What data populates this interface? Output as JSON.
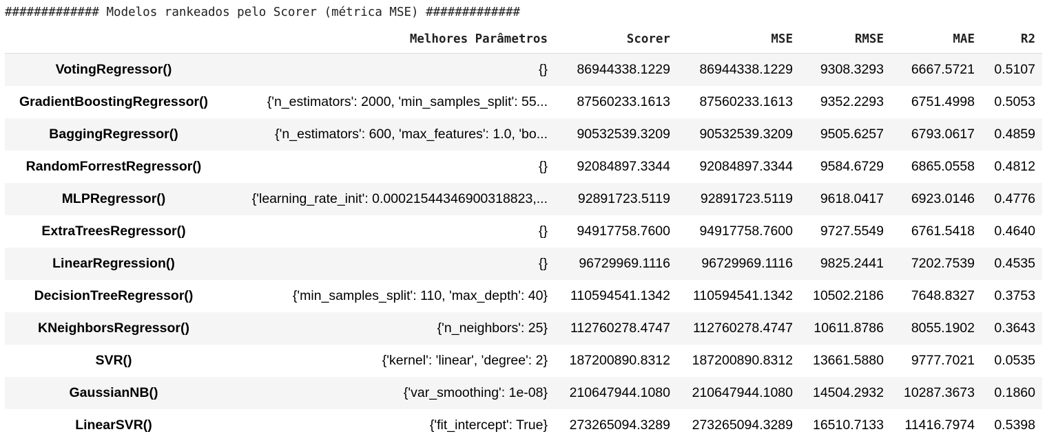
{
  "title": "############# Modelos rankeados pelo Scorer (métrica MSE) #############",
  "table": {
    "columns": [
      "",
      "Melhores Parâmetros",
      "Scorer",
      "MSE",
      "RMSE",
      "MAE",
      "R2"
    ],
    "rows": [
      {
        "model": "VotingRegressor()",
        "params": "{}",
        "scorer": "86944338.1229",
        "mse": "86944338.1229",
        "rmse": "9308.3293",
        "mae": "6667.5721",
        "r2": "0.5107"
      },
      {
        "model": "GradientBoostingRegressor()",
        "params": "{'n_estimators': 2000, 'min_samples_split': 55...",
        "scorer": "87560233.1613",
        "mse": "87560233.1613",
        "rmse": "9352.2293",
        "mae": "6751.4998",
        "r2": "0.5053"
      },
      {
        "model": "BaggingRegressor()",
        "params": "{'n_estimators': 600, 'max_features': 1.0, 'bo...",
        "scorer": "90532539.3209",
        "mse": "90532539.3209",
        "rmse": "9505.6257",
        "mae": "6793.0617",
        "r2": "0.4859"
      },
      {
        "model": "RandomForrestRegressor()",
        "params": "{}",
        "scorer": "92084897.3344",
        "mse": "92084897.3344",
        "rmse": "9584.6729",
        "mae": "6865.0558",
        "r2": "0.4812"
      },
      {
        "model": "MLPRegressor()",
        "params": "{'learning_rate_init': 0.00021544346900318823,...",
        "scorer": "92891723.5119",
        "mse": "92891723.5119",
        "rmse": "9618.0417",
        "mae": "6923.0146",
        "r2": "0.4776"
      },
      {
        "model": "ExtraTreesRegressor()",
        "params": "{}",
        "scorer": "94917758.7600",
        "mse": "94917758.7600",
        "rmse": "9727.5549",
        "mae": "6761.5418",
        "r2": "0.4640"
      },
      {
        "model": "LinearRegression()",
        "params": "{}",
        "scorer": "96729969.1116",
        "mse": "96729969.1116",
        "rmse": "9825.2441",
        "mae": "7202.7539",
        "r2": "0.4535"
      },
      {
        "model": "DecisionTreeRegressor()",
        "params": "{'min_samples_split': 110, 'max_depth': 40}",
        "scorer": "110594541.1342",
        "mse": "110594541.1342",
        "rmse": "10502.2186",
        "mae": "7648.8327",
        "r2": "0.3753"
      },
      {
        "model": "KNeighborsRegressor()",
        "params": "{'n_neighbors': 25}",
        "scorer": "112760278.4747",
        "mse": "112760278.4747",
        "rmse": "10611.8786",
        "mae": "8055.1902",
        "r2": "0.3643"
      },
      {
        "model": "SVR()",
        "params": "{'kernel': 'linear', 'degree': 2}",
        "scorer": "187200890.8312",
        "mse": "187200890.8312",
        "rmse": "13661.5880",
        "mae": "9777.7021",
        "r2": "0.0535"
      },
      {
        "model": "GaussianNB()",
        "params": "{'var_smoothing': 1e-08}",
        "scorer": "210647944.1080",
        "mse": "210647944.1080",
        "rmse": "14504.2932",
        "mae": "10287.3673",
        "r2": "0.1860"
      },
      {
        "model": "LinearSVR()",
        "params": "{'fit_intercept': True}",
        "scorer": "273265094.3289",
        "mse": "273265094.3289",
        "rmse": "16510.7133",
        "mae": "11416.7974",
        "r2": "0.5398"
      }
    ]
  }
}
